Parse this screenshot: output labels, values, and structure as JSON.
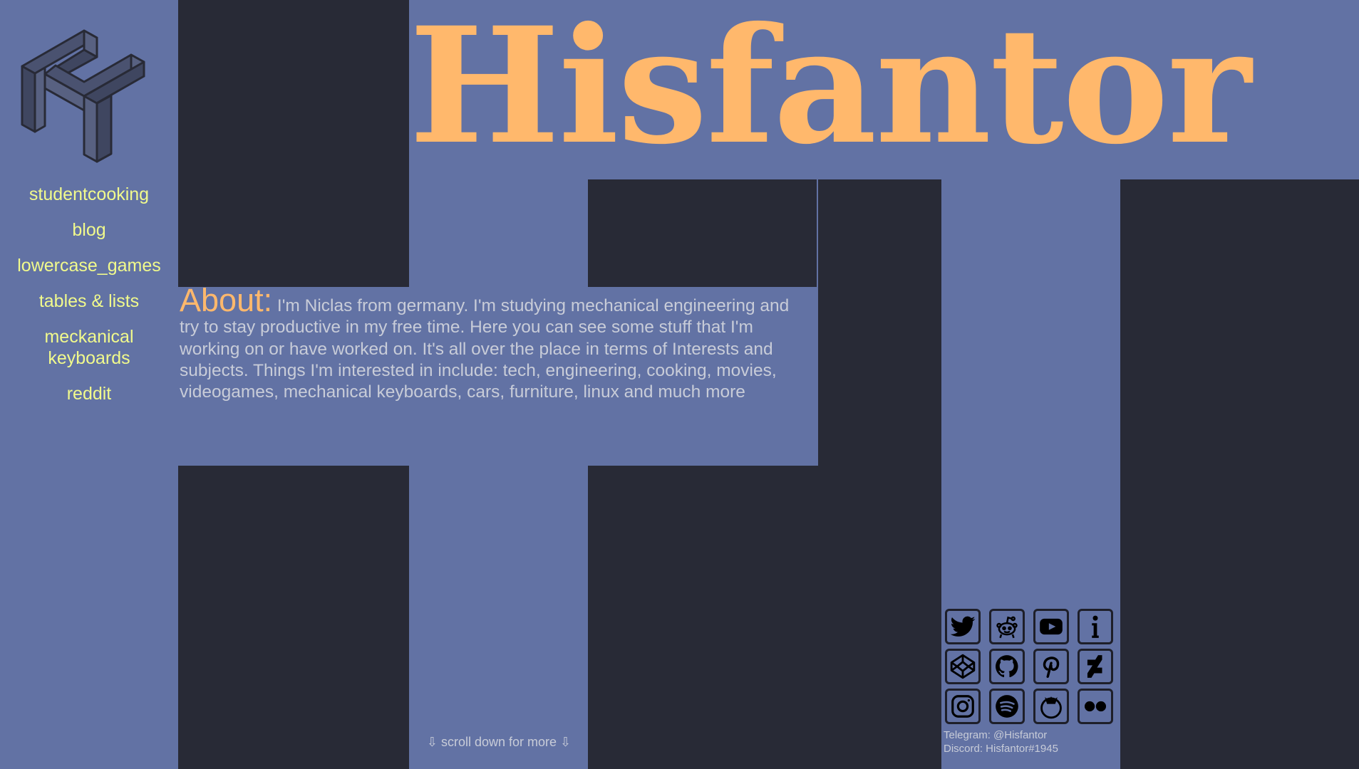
{
  "site": {
    "title": "Hisfantor"
  },
  "colors": {
    "background": "#6272a4",
    "dark": "#282a36",
    "accent": "#ffb86c",
    "nav": "#f1fa8c",
    "text": "#c8ccd8"
  },
  "logo": {
    "icon": "hisfantor-logo"
  },
  "nav": {
    "items": [
      {
        "label": "studentcooking"
      },
      {
        "label": "blog"
      },
      {
        "label": "lowercase_games"
      },
      {
        "label": "tables & lists"
      },
      {
        "label": "meckanical keyboards"
      },
      {
        "label": "reddit"
      }
    ]
  },
  "about": {
    "label": "About:",
    "text": "I'm Niclas from germany. I'm studying mechanical engineering and try to stay productive in my free time. Here you can see some stuff that I'm working on or have worked on. It's all over the place in terms of Interests and subjects. Things I'm interested in include: tech, engineering, cooking, movies, videogames, mechanical keyboards, cars, furniture, linux and much more"
  },
  "scroll_hint": "⇩ scroll down for more ⇩",
  "social": {
    "icons": [
      "twitter-icon",
      "reddit-icon",
      "youtube-icon",
      "info-icon",
      "codepen-icon",
      "github-icon",
      "pinterest-icon",
      "deviantart-icon",
      "instagram-icon",
      "spotify-icon",
      "tomato-icon",
      "flickr-icon"
    ]
  },
  "contact": {
    "telegram": "Telegram: @Hisfantor",
    "discord": "Discord: Hisfantor#1945"
  }
}
